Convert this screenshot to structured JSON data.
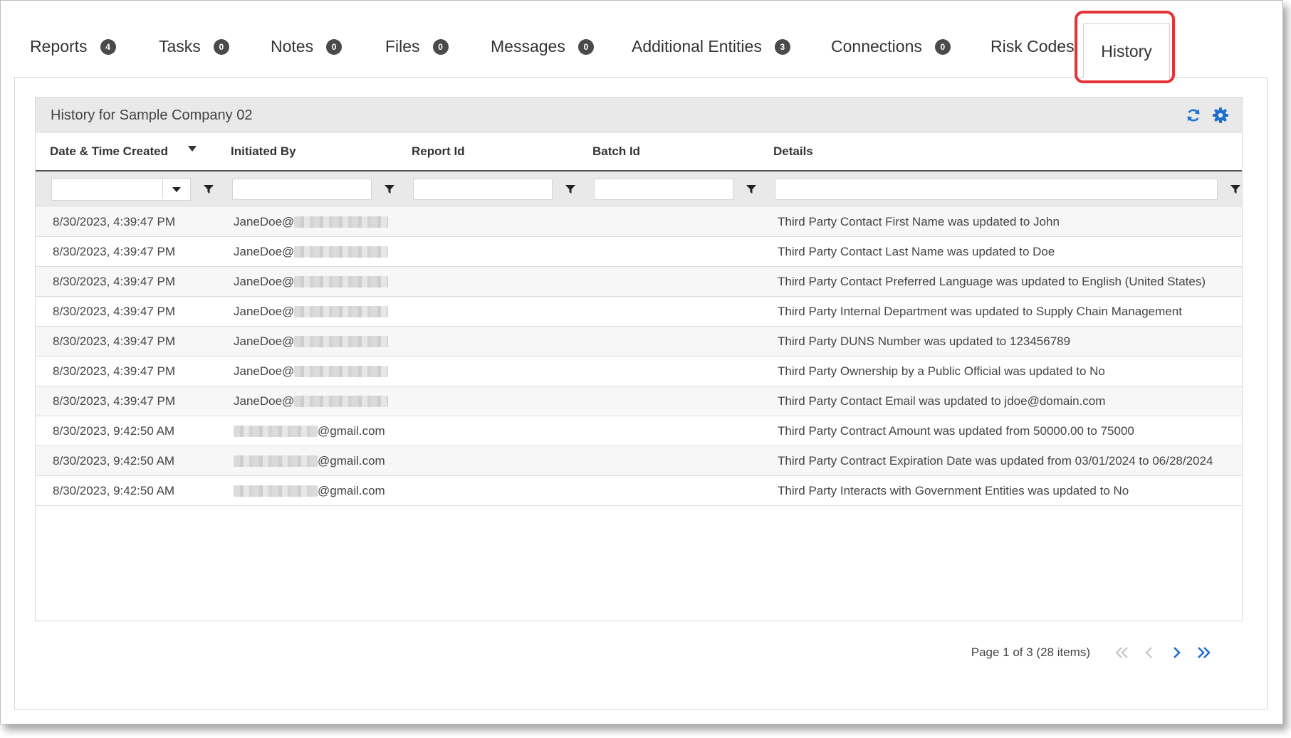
{
  "tabs": [
    {
      "label": "Reports",
      "count": "4"
    },
    {
      "label": "Tasks",
      "count": "0"
    },
    {
      "label": "Notes",
      "count": "0"
    },
    {
      "label": "Files",
      "count": "0"
    },
    {
      "label": "Messages",
      "count": "0"
    },
    {
      "label": "Additional Entities",
      "count": "3"
    },
    {
      "label": "Connections",
      "count": "0"
    },
    {
      "label": "Risk Codes",
      "count": ""
    },
    {
      "label": "History",
      "count": "",
      "active": true
    }
  ],
  "grid": {
    "title": "History for Sample Company 02",
    "tool_icons": [
      "refresh-icon",
      "gear-icon"
    ],
    "columns": [
      "Date & Time Created",
      "Initiated By",
      "Report Id",
      "Batch Id",
      "Details"
    ],
    "sorted_column": "Date & Time Created",
    "filters": {
      "date": "",
      "initiated_by": "",
      "report_id": "",
      "batch_id": "",
      "details": ""
    },
    "rows": [
      {
        "date": "8/30/2023, 4:39:47 PM",
        "by_prefix": "JaneDoe@",
        "by_suffix": "",
        "report_id": "",
        "batch_id": "",
        "details": "Third Party Contact First Name was updated to John"
      },
      {
        "date": "8/30/2023, 4:39:47 PM",
        "by_prefix": "JaneDoe@",
        "by_suffix": "",
        "report_id": "",
        "batch_id": "",
        "details": "Third Party Contact Last Name was updated to Doe"
      },
      {
        "date": "8/30/2023, 4:39:47 PM",
        "by_prefix": "JaneDoe@",
        "by_suffix": "",
        "report_id": "",
        "batch_id": "",
        "details": "Third Party Contact Preferred Language was updated to English (United States)"
      },
      {
        "date": "8/30/2023, 4:39:47 PM",
        "by_prefix": "JaneDoe@",
        "by_suffix": "",
        "report_id": "",
        "batch_id": "",
        "details": "Third Party Internal Department was updated to Supply Chain Management"
      },
      {
        "date": "8/30/2023, 4:39:47 PM",
        "by_prefix": "JaneDoe@",
        "by_suffix": "",
        "report_id": "",
        "batch_id": "",
        "details": "Third Party DUNS Number was updated to 123456789"
      },
      {
        "date": "8/30/2023, 4:39:47 PM",
        "by_prefix": "JaneDoe@",
        "by_suffix": "",
        "report_id": "",
        "batch_id": "",
        "details": "Third Party Ownership by a Public Official was updated to No"
      },
      {
        "date": "8/30/2023, 4:39:47 PM",
        "by_prefix": "JaneDoe@",
        "by_suffix": "",
        "report_id": "",
        "batch_id": "",
        "details": "Third Party Contact Email was updated to jdoe@domain.com"
      },
      {
        "date": "8/30/2023, 9:42:50 AM",
        "by_prefix": "",
        "by_suffix": "@gmail.com",
        "report_id": "",
        "batch_id": "",
        "details": "Third Party Contract Amount was updated from 50000.00 to 75000"
      },
      {
        "date": "8/30/2023, 9:42:50 AM",
        "by_prefix": "",
        "by_suffix": "@gmail.com",
        "report_id": "",
        "batch_id": "",
        "details": "Third Party Contract Expiration Date was updated from 03/01/2024 to 06/28/2024"
      },
      {
        "date": "8/30/2023, 9:42:50 AM",
        "by_prefix": "",
        "by_suffix": "@gmail.com",
        "report_id": "",
        "batch_id": "",
        "details": "Third Party Interacts with Government Entities was updated to No"
      }
    ]
  },
  "pager": {
    "info": "Page 1 of 3 (28 items)",
    "buttons": [
      "first-page-icon",
      "prev-page-icon",
      "next-page-icon",
      "last-page-icon"
    ]
  },
  "colors": {
    "highlight": "#e53238",
    "accent": "#1f6fd1",
    "badge": "#4a4a4a",
    "header_bg": "#e9e9e9"
  }
}
